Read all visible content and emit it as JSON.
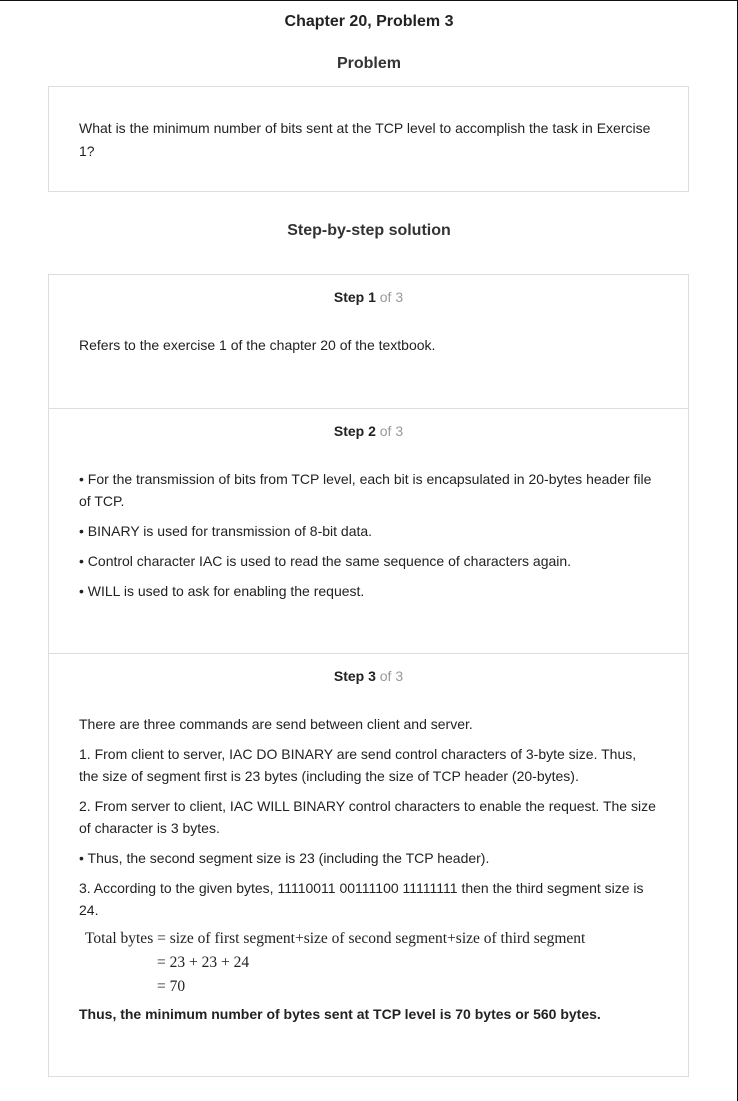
{
  "chapter_title": "Chapter 20, Problem 3",
  "problem": {
    "heading": "Problem",
    "text": "What is the minimum number of bits sent at the TCP level to accomplish the task in Exercise 1?"
  },
  "solution_heading": "Step-by-step solution",
  "steps": [
    {
      "label": "Step 1",
      "of": "of 3",
      "paragraphs": [
        "Refers to the exercise 1 of the chapter 20 of the textbook."
      ]
    },
    {
      "label": "Step 2",
      "of": "of 3",
      "paragraphs": [
        "• For the transmission of bits from TCP level, each bit is encapsulated in 20-bytes header file of TCP.",
        "• BINARY is used for transmission of 8-bit data.",
        "• Control character IAC is used to read the same sequence of characters again.",
        "• WILL is used to ask for enabling the request."
      ]
    },
    {
      "label": "Step 3",
      "of": "of 3",
      "paragraphs": [
        "There are three commands are send between client and server.",
        "1. From client to server, IAC DO BINARY are send control characters of 3-byte size. Thus, the size of segment first is 23 bytes (including the size of TCP header (20-bytes).",
        "2. From server to client, IAC WILL BINARY control characters to enable the request. The size of character is 3 bytes.",
        "• Thus, the second segment size is 23 (including the TCP header).",
        "3. According to the given bytes, 11110011 00111100 11111111 then the third segment size is 24."
      ],
      "math_lines": [
        "Total bytes = size of first segment+size of second segment+size of third segment",
        "= 23 + 23 + 24",
        "= 70"
      ],
      "conclusion": "Thus, the minimum number of bytes sent at TCP level is 70 bytes or 560 bytes."
    }
  ]
}
